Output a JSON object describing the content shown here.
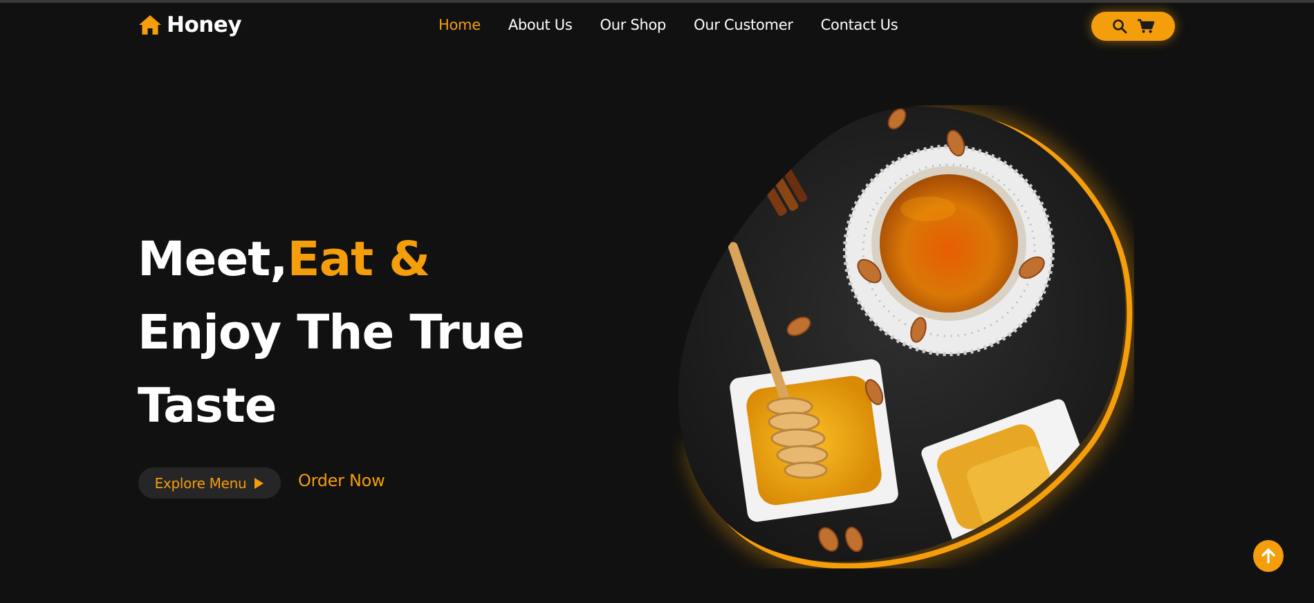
{
  "brand": {
    "name": "Honey",
    "logo_icon": "home-icon",
    "accent_color": "#f59e0b",
    "background_color": "#111111"
  },
  "nav": {
    "items": [
      {
        "label": "Home",
        "active": true
      },
      {
        "label": "About Us",
        "active": false
      },
      {
        "label": "Our Shop",
        "active": false
      },
      {
        "label": "Our Customer",
        "active": false
      },
      {
        "label": "Contact Us",
        "active": false
      }
    ],
    "actions": {
      "search_icon": "search-icon",
      "cart_icon": "cart-icon"
    }
  },
  "hero": {
    "title_part1": "Meet,",
    "title_accent": "Eat &",
    "title_line2": "Enjoy The True",
    "title_line3": "Taste",
    "explore_label": "Explore Menu",
    "explore_icon": "play-icon",
    "order_label": "Order Now",
    "image_alt": "honey-still-life"
  },
  "scroll_top": {
    "icon": "arrow-up-icon"
  }
}
